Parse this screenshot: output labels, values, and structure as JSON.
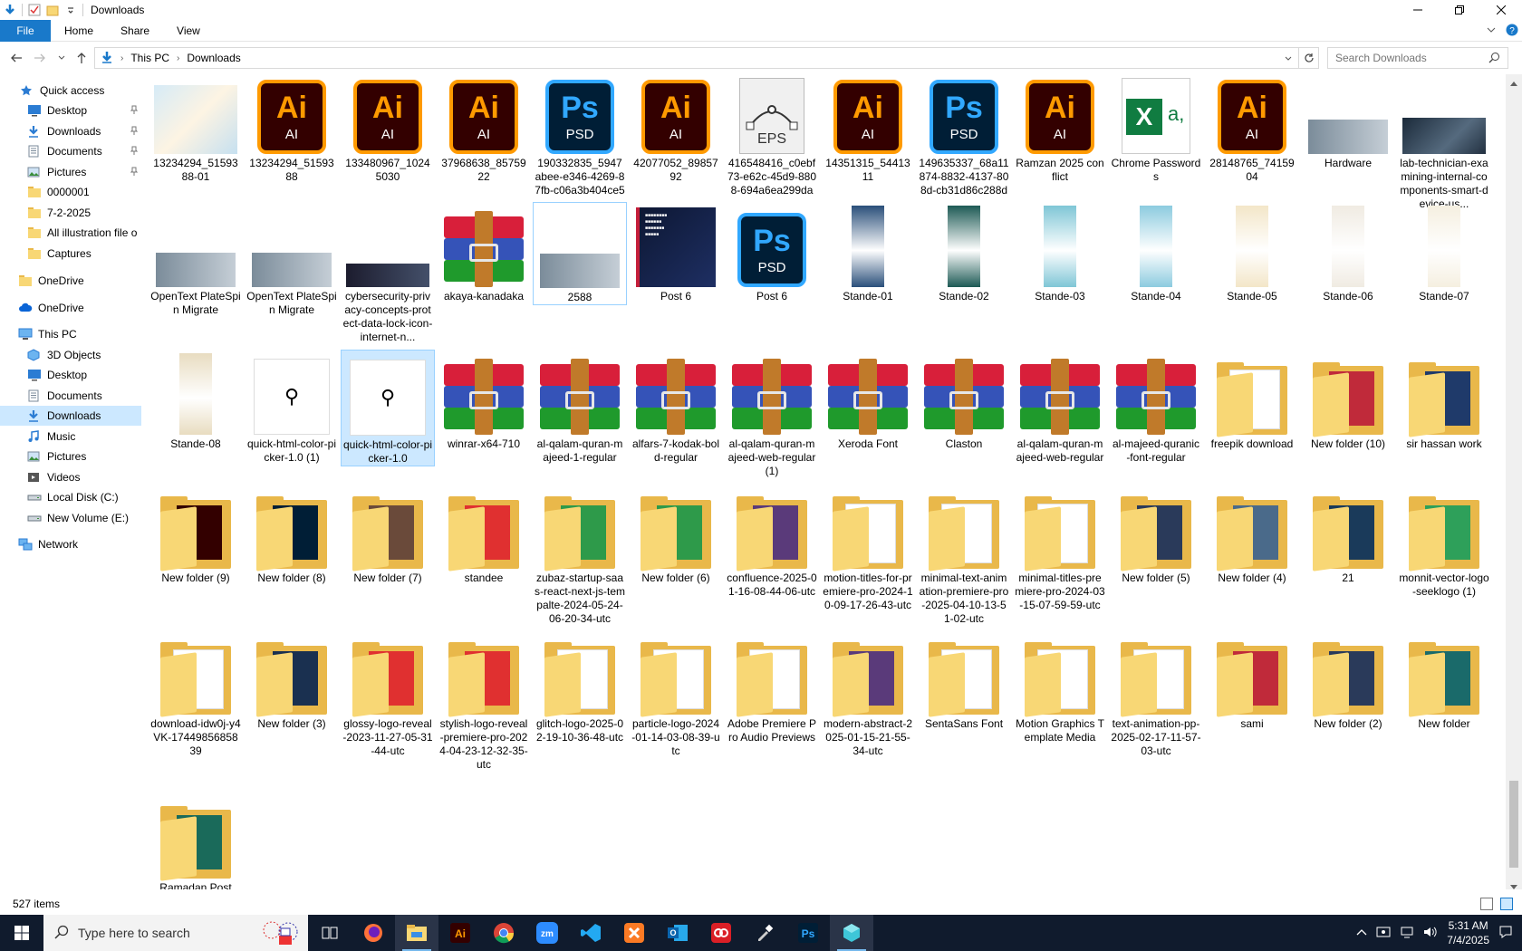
{
  "window": {
    "title": "Downloads"
  },
  "ribbon": {
    "tabs": [
      "File",
      "Home",
      "Share",
      "View"
    ]
  },
  "address": {
    "crumbs": [
      "This PC",
      "Downloads"
    ]
  },
  "search": {
    "placeholder": "Search Downloads"
  },
  "nav": {
    "items": [
      {
        "label": "Quick access",
        "icon": "star-icon",
        "pinned": false
      },
      {
        "label": "Desktop",
        "icon": "desktop-icon",
        "pinned": true
      },
      {
        "label": "Downloads",
        "icon": "download-icon",
        "pinned": true
      },
      {
        "label": "Documents",
        "icon": "documents-icon",
        "pinned": true
      },
      {
        "label": "Pictures",
        "icon": "pictures-icon",
        "pinned": true
      },
      {
        "label": "0000001",
        "icon": "folder-icon",
        "pinned": false
      },
      {
        "label": "7-2-2025",
        "icon": "folder-icon",
        "pinned": false
      },
      {
        "label": "All illustration file o",
        "icon": "folder-icon",
        "pinned": false
      },
      {
        "label": "Captures",
        "icon": "folder-icon",
        "pinned": false
      },
      {
        "label": "OneDrive",
        "icon": "folder-icon",
        "pinned": false
      },
      {
        "label": "OneDrive",
        "icon": "cloud-icon",
        "pinned": false
      },
      {
        "label": "This PC",
        "icon": "computer-icon",
        "pinned": false
      },
      {
        "label": "3D Objects",
        "icon": "3d-objects-icon",
        "pinned": false
      },
      {
        "label": "Desktop",
        "icon": "desktop-icon",
        "pinned": false
      },
      {
        "label": "Documents",
        "icon": "documents-icon",
        "pinned": false
      },
      {
        "label": "Downloads",
        "icon": "download-icon",
        "pinned": false,
        "selected": true
      },
      {
        "label": "Music",
        "icon": "music-icon",
        "pinned": false
      },
      {
        "label": "Pictures",
        "icon": "pictures-icon",
        "pinned": false
      },
      {
        "label": "Videos",
        "icon": "videos-icon",
        "pinned": false
      },
      {
        "label": "Local Disk (C:)",
        "icon": "drive-icon",
        "pinned": false
      },
      {
        "label": "New Volume (E:)",
        "icon": "drive-icon",
        "pinned": false
      },
      {
        "label": "Network",
        "icon": "network-icon",
        "pinned": false
      }
    ]
  },
  "files": [
    [
      {
        "name": "13234294_5159388-01",
        "type": "image"
      },
      {
        "name": "13234294_5159388",
        "type": "ai"
      },
      {
        "name": "133480967_10245030",
        "type": "ai"
      },
      {
        "name": "37968638_8575922",
        "type": "ai"
      },
      {
        "name": "190332835_5947abee-e346-4269-87fb-c06a3b404ce5",
        "type": "psd"
      },
      {
        "name": "42077052_8985792",
        "type": "ai"
      },
      {
        "name": "416548416_c0ebf73-e62c-45d9-8808-694a6ea299da",
        "type": "eps"
      },
      {
        "name": "14351315_5441311",
        "type": "ai"
      },
      {
        "name": "149635337_68a11874-8832-4137-808d-cb31d86c288d",
        "type": "psd"
      },
      {
        "name": "Ramzan 2025 conflict",
        "type": "ai"
      },
      {
        "name": "Chrome Passwords",
        "type": "xlsx"
      },
      {
        "name": "28148765_7415904",
        "type": "ai"
      },
      {
        "name": "Hardware",
        "type": "photo"
      },
      {
        "name": "lab-technician-examining-internal-components-smart-device-us...",
        "type": "darkimg"
      }
    ],
    [
      {
        "name": "OpenText PlateSpin Migrate",
        "type": "photo"
      },
      {
        "name": "OpenText PlateSpin Migrate",
        "type": "photo"
      },
      {
        "name": "cybersecurity-privacy-concepts-protect-data-lock-icon-internet-n...",
        "type": "cyber"
      },
      {
        "name": "akaya-kanadaka",
        "type": "rar"
      },
      {
        "name": "2588",
        "type": "photo",
        "focused": true
      },
      {
        "name": "Post 6",
        "type": "post"
      },
      {
        "name": "Post 6",
        "type": "psd"
      },
      {
        "name": "Stande-01",
        "type": "stand",
        "color": "#2a4f7a"
      },
      {
        "name": "Stande-02",
        "type": "stand",
        "color": "#1d5a55"
      },
      {
        "name": "Stande-03",
        "type": "stand",
        "color": "#7fc6d6"
      },
      {
        "name": "Stande-04",
        "type": "stand",
        "color": "#8ccbdf"
      },
      {
        "name": "Stande-05",
        "type": "stand",
        "color": "#f3e6c8"
      },
      {
        "name": "Stande-06",
        "type": "stand",
        "color": "#f0ebe2"
      },
      {
        "name": "Stande-07",
        "type": "stand",
        "color": "#f5efe0"
      }
    ],
    [
      {
        "name": "Stande-08",
        "type": "stand",
        "color": "#e8dcc0"
      },
      {
        "name": "quick-html-color-picker-1.0 (1)",
        "type": "dropper"
      },
      {
        "name": "quick-html-color-picker-1.0",
        "type": "dropper",
        "selected": true
      },
      {
        "name": "winrar-x64-710",
        "type": "rar"
      },
      {
        "name": "al-qalam-quran-majeed-1-regular",
        "type": "rar"
      },
      {
        "name": "alfars-7-kodak-bold-regular",
        "type": "rar"
      },
      {
        "name": "al-qalam-quran-majeed-web-regular (1)",
        "type": "rar"
      },
      {
        "name": "Xeroda Font",
        "type": "rar"
      },
      {
        "name": "Claston",
        "type": "rar"
      },
      {
        "name": "al-qalam-quran-majeed-web-regular",
        "type": "rar"
      },
      {
        "name": "al-majeed-quranic-font-regular",
        "type": "rar"
      },
      {
        "name": "freepik download",
        "type": "folder"
      },
      {
        "name": "New folder (10)",
        "type": "folder",
        "inner": "#c02a3a"
      },
      {
        "name": "sir hassan work",
        "type": "folder",
        "inner": "#1f3a6a"
      }
    ],
    [
      {
        "name": "New folder (9)",
        "type": "folder",
        "inner": "#330000"
      },
      {
        "name": "New folder (8)",
        "type": "folder",
        "inner": "#001e36"
      },
      {
        "name": "New folder (7)",
        "type": "folder",
        "inner": "#6a4a3a"
      },
      {
        "name": "standee",
        "type": "folder",
        "inner": "#e03030"
      },
      {
        "name": "zubaz-startup-saas-react-next-js-tempalte-2024-05-24-06-20-34-utc",
        "type": "folder",
        "inner": "#2e9a4a"
      },
      {
        "name": "New folder (6)",
        "type": "folder",
        "inner": "#2e9a4a"
      },
      {
        "name": "confluence-2025-01-16-08-44-06-utc",
        "type": "folder",
        "inner": "#5a3a7a"
      },
      {
        "name": "motion-titles-for-premiere-pro-2024-10-09-17-26-43-utc",
        "type": "folder"
      },
      {
        "name": "minimal-text-animation-premiere-pro-2025-04-10-13-51-02-utc",
        "type": "folder"
      },
      {
        "name": "minimal-titles-premiere-pro-2024-03-15-07-59-59-utc",
        "type": "folder"
      },
      {
        "name": "New folder (5)",
        "type": "folder",
        "inner": "#2a3a5a"
      },
      {
        "name": "New folder (4)",
        "type": "folder",
        "inner": "#4a6a8a"
      },
      {
        "name": "21",
        "type": "folder",
        "inner": "#1a3a5a"
      },
      {
        "name": "monnit-vector-logo-seeklogo (1)",
        "type": "folder",
        "inner": "#2ea05a"
      }
    ],
    [
      {
        "name": "download-idw0j-y4VK-1744985685839",
        "type": "folder"
      },
      {
        "name": "New folder (3)",
        "type": "folder",
        "inner": "#1a3050"
      },
      {
        "name": "glossy-logo-reveal-2023-11-27-05-31-44-utc",
        "type": "folder",
        "inner": "#e03030"
      },
      {
        "name": "stylish-logo-reveal-premiere-pro-2024-04-23-12-32-35-utc",
        "type": "folder",
        "inner": "#e03030"
      },
      {
        "name": "glitch-logo-2025-02-19-10-36-48-utc",
        "type": "folder"
      },
      {
        "name": "particle-logo-2024-01-14-03-08-39-utc",
        "type": "folder"
      },
      {
        "name": "Adobe Premiere Pro Audio Previews",
        "type": "folder"
      },
      {
        "name": "modern-abstract-2025-01-15-21-55-34-utc",
        "type": "folder",
        "inner": "#5a3a7a"
      },
      {
        "name": "SentaSans Font",
        "type": "folder"
      },
      {
        "name": "Motion Graphics Template Media",
        "type": "folder"
      },
      {
        "name": "text-animation-pp-2025-02-17-11-57-03-utc",
        "type": "folder"
      },
      {
        "name": "sami",
        "type": "folder",
        "inner": "#c02a3a"
      },
      {
        "name": "New folder (2)",
        "type": "folder",
        "inner": "#2a3a5a"
      },
      {
        "name": "New folder",
        "type": "folder",
        "inner": "#1a6a6a"
      }
    ],
    [
      {
        "name": "Ramadan Post",
        "type": "folder",
        "inner": "#1a6a5a"
      }
    ]
  ],
  "status": {
    "count": "527 items"
  },
  "taskbar": {
    "search_placeholder": "Type here to search",
    "time": "5:31 AM",
    "date": "7/4/2025"
  },
  "colors": {
    "accent": "#1979ca",
    "selection": "#cce8ff",
    "taskbar": "#101b2d"
  }
}
